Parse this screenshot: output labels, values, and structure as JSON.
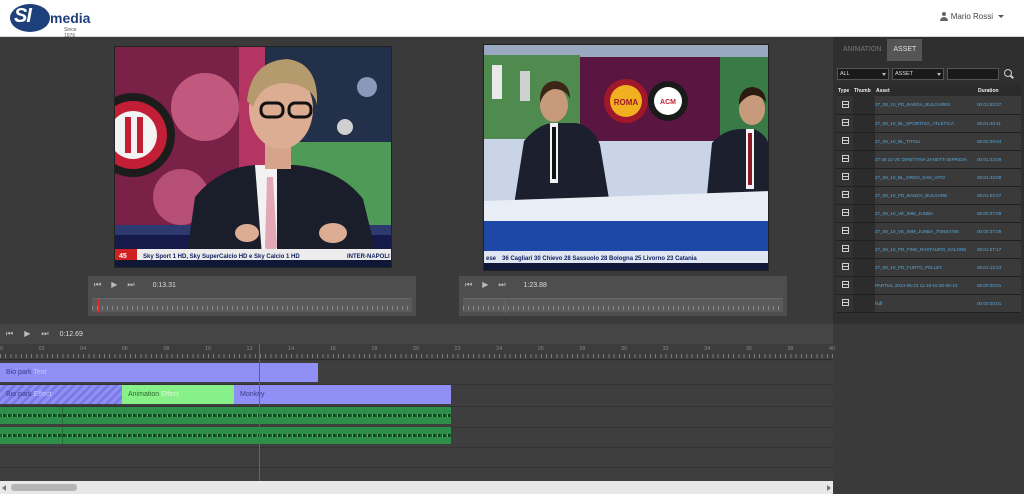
{
  "header": {
    "logo": {
      "mark": "SI",
      "wordmark": "media",
      "since": "Since 1976"
    },
    "user": {
      "name": "Mario Rossi",
      "icon": "user-icon"
    }
  },
  "players": {
    "left": {
      "time": "0:13.31",
      "progress": 0.02,
      "ticker": "Sky Sport 1 HD, Sky SuperCalcio HD e Sky Calcio 1 HD",
      "ticker_right": "INTER-NAPOLI",
      "channel_number": "45"
    },
    "right": {
      "time": "1:23.88",
      "progress": 0.13,
      "ticker": "36 Cagliari   30 Chievo   28 Sassuolo   28 Bologna   25 Livorno   23 Catania",
      "ticker_left": "ese",
      "badges": [
        "ROMA",
        "ACM"
      ]
    },
    "controls": {
      "prev_icon": "skip-back-icon",
      "play_icon": "play-icon",
      "next_icon": "skip-forward-icon"
    }
  },
  "asset_panel": {
    "tabs": [
      {
        "label": "ANIMATION",
        "active": false
      },
      {
        "label": "ASSET",
        "active": true
      }
    ],
    "filter_1": "ALL",
    "filter_2": "ASSET",
    "search_value": "",
    "columns": [
      "Type",
      "Thumb",
      "Asset",
      "Duration"
    ],
    "rows": [
      {
        "asset": "27_08_10_PD_BANDA_BULGAREX",
        "duration": "00:01:52:07"
      },
      {
        "asset": "27_08_10_BL_SPORTIVO_ATLETICA",
        "duration": "00:01:48:11"
      },
      {
        "asset": "27_08_10_BL_TITOLI",
        "duration": "00:02:09:04"
      },
      {
        "asset": "27 08 10 VE DIRETTINA ZANETTI BIPRIDIA",
        "duration": "00:01:42:09"
      },
      {
        "asset": "27_08_10_BL_ORSO_SAN_VITO",
        "duration": "00:01:43:08"
      },
      {
        "asset": "27_08_10_PD_BANDA_BULGARE",
        "duration": "00:01:52:07"
      },
      {
        "asset": "27_08_10_VE_IMM_JUNBA",
        "duration": "00:00:37:09"
      },
      {
        "asset": "27_08_10_VE_IMM_JUNBA_700644766",
        "duration": "00:00:37:09"
      },
      {
        "asset": "27_08_10_PD_FINE_RASTAURO_SALONE",
        "duration": "00:01:57:17"
      },
      {
        "asset": "27_08_10_PD_FURTO_PELLET",
        "duration": "00:01:13:23"
      },
      {
        "asset": "PARTIAL 2014-05-23 11-18-15 00-00-14",
        "duration": "00:00:00:01"
      },
      {
        "asset": "fsdf",
        "duration": "00:00:00:01"
      }
    ]
  },
  "timeline": {
    "time": "0:12.69",
    "ticks": [
      "00",
      "02",
      "04",
      "06",
      "08",
      "10",
      "12",
      "14",
      "16",
      "18",
      "20",
      "22",
      "24",
      "26",
      "28",
      "30",
      "32",
      "34",
      "36",
      "38",
      "40"
    ],
    "clips": {
      "text_clip": {
        "label": "Bio park",
        "effect": "Text"
      },
      "hatch_clip": {
        "label": "Bio park",
        "effect": "Effect"
      },
      "anim_clip": {
        "label": "Animation",
        "effect": "Effect"
      },
      "monkey_clip": {
        "label": "Monkey"
      }
    }
  },
  "colors": {
    "accent_blue": "#8f8ff5",
    "accent_green": "#88f088",
    "audio_green": "#2e8f4b",
    "playhead": "#e03030",
    "asset_link": "#55aadd"
  }
}
